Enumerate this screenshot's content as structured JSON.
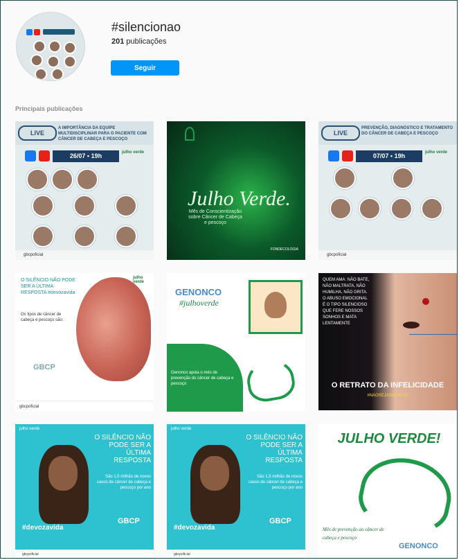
{
  "header": {
    "hashtag": "#silencionao",
    "post_count": "201",
    "post_count_label": "publicações",
    "follow_label": "Seguir"
  },
  "section": {
    "label": "Principais publicações"
  },
  "posts": [
    {
      "live": "LIVE",
      "headline": "A IMPORTÂNCIA DA EQUIPE MULTIDISCIPLINAR PARA O PACIENTE COM CÂNCER DE CABEÇA E PESCOÇO",
      "date": "26/07 • 19h",
      "badge": "julho verde",
      "footer": "gbcpoficial"
    },
    {
      "title": "Julho Verde.",
      "sub": "Mês de Conscientização sobre Câncer de Cabeça e pescoço",
      "brand": "FONDECOLOGIA"
    },
    {
      "live": "LIVE",
      "headline": "PREVENÇÃO, DIAGNÓSTICO E TRATAMENTO DO CÂNCER DE CABEÇA E PESCOÇO",
      "date": "07/07 • 19h",
      "badge": "julho verde",
      "footer": "gbcpoficial"
    },
    {
      "headline": "O SILÊNCIO NÃO PODE SER A ÚLTIMA RESPOSTA #devozavida",
      "body": "Os tipos de câncer de cabeça e pescoço são:",
      "badge": "julho verde",
      "org": "GBCP",
      "footer": "gbcpoficial"
    },
    {
      "logo": "GENONCO",
      "script": "#julhoverde",
      "body": "Genonco apoia o mês de prevenção do câncer de cabeça e pescoço"
    },
    {
      "text": "QUEM AMA: NÃO BATE, NÃO MALTRATA, NÃO HUMILHA, NÃO GRITA. O ABUSO EMOCIONAL É O TIPO SILENCIOSO QUE FERE NOSSOS SONHOS E MATA LENTAMENTE",
      "bottom": "O RETRATO DA INFELICIDADE",
      "bottom_sub": "#NAOSEJASILENCIO"
    },
    {
      "badge": "julho verde",
      "headline": "O SILÊNCIO NÃO PODE SER A ÚLTIMA RESPOSTA",
      "stat": "São 1,5 milhão de novos casos de câncer de cabeça e pescoço por ano",
      "hashtag": "#devozavida",
      "org": "GBCP",
      "footer": "gbcpoficial"
    },
    {
      "badge": "julho verde",
      "headline": "O SILÊNCIO NÃO PODE SER A ÚLTIMA RESPOSTA",
      "stat": "São 1,5 milhão de novos casos de câncer de cabeça e pescoço por ano",
      "hashtag": "#devozavida",
      "org": "GBCP",
      "footer": "gbcpoficial"
    },
    {
      "title": "JULHO VERDE!",
      "desc": "Mês de prevenção ao câncer de cabeça e pescoço",
      "logo": "GENONCO"
    }
  ],
  "colors": {
    "follow_button": "#0095f6",
    "green_accent": "#1f9a4a",
    "teal": "#2ec1cf"
  }
}
